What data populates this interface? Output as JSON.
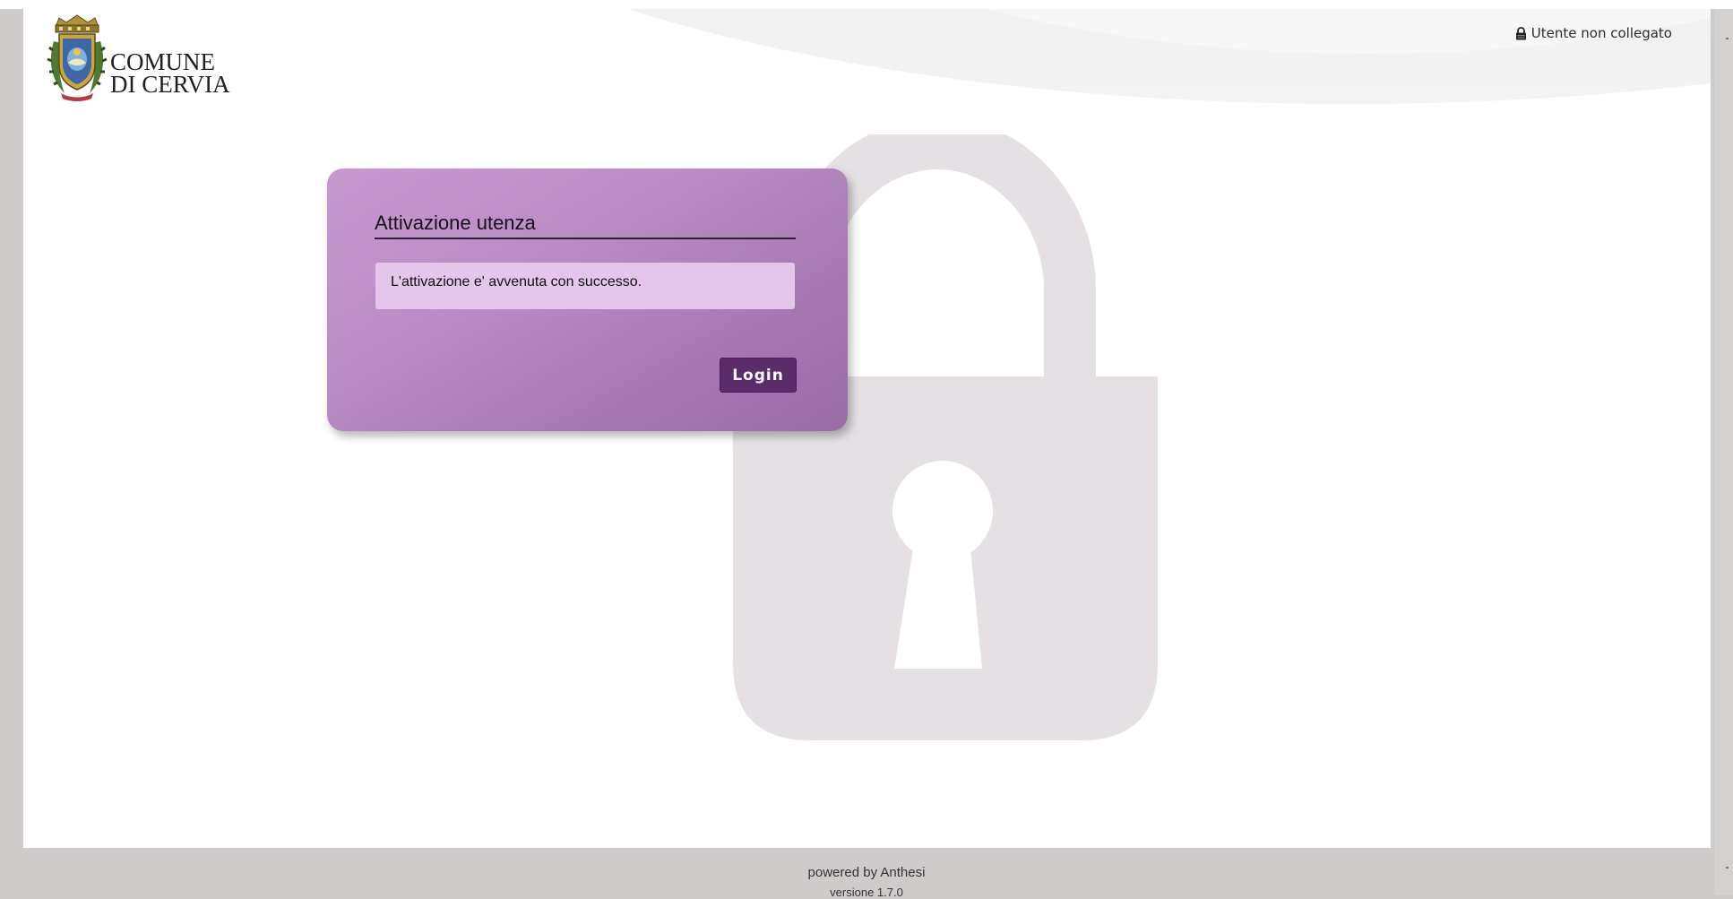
{
  "header": {
    "logo": {
      "line1": "COMUNE",
      "line2": "DI CERVIA",
      "crest_icon": "cervia-coat-of-arms-icon"
    },
    "user_status": {
      "icon": "user-lock-icon",
      "text": "Utente non collegato"
    }
  },
  "card": {
    "title": "Attivazione utenza",
    "message": "L'attivazione e' avvenuta con successo.",
    "login_label": "Login"
  },
  "background": {
    "icon": "padlock-icon"
  },
  "footer": {
    "powered_by": "powered by Anthesi",
    "version": "versione 1.7.0"
  },
  "colors": {
    "card_gradient_start": "#c799d0",
    "card_gradient_end": "#9a6ca6",
    "message_bg": "#e4c6ea",
    "button_bg": "#5c2b6a",
    "lock_gray": "#e4e0e4",
    "page_gray": "#cfcbcb"
  }
}
